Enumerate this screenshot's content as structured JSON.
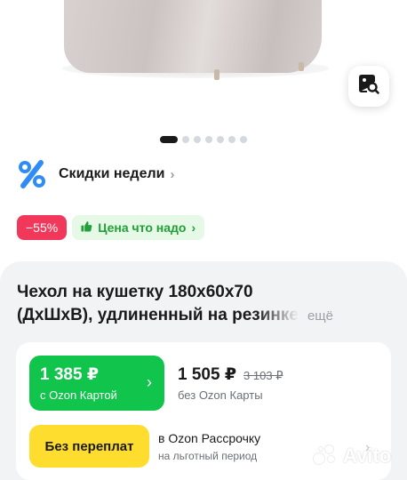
{
  "gallery": {
    "total_images": 7,
    "active_index": 0
  },
  "weekly_deals": {
    "label": "Скидки недели",
    "icon": "percent-icon",
    "chevron": "›"
  },
  "badges": {
    "discount": "−55%",
    "price_label": "Цена что надо",
    "price_chevron": "›"
  },
  "product": {
    "title_line1": "Чехол на кушетку 180х60х70",
    "title_line2": "(ДхШхВ), удлиненный на резинке",
    "more_link": "ещё"
  },
  "pricing": {
    "ozon_card_price": "1 385 ₽",
    "ozon_card_label": "с Ozon Картой",
    "regular_price": "1 505 ₽",
    "old_price": "3 103 ₽",
    "regular_label": "без Ozon Карты",
    "installment_button": "Без переплат",
    "installment_line1": "в Ozon Рассрочку",
    "installment_line2": "на льготный период"
  },
  "watermark": "Avito",
  "colors": {
    "accent_green": "#10c44c",
    "discount_red": "#f2385a",
    "installment_yellow": "#fedd2e",
    "percent_blue": "#2f8cf7"
  }
}
